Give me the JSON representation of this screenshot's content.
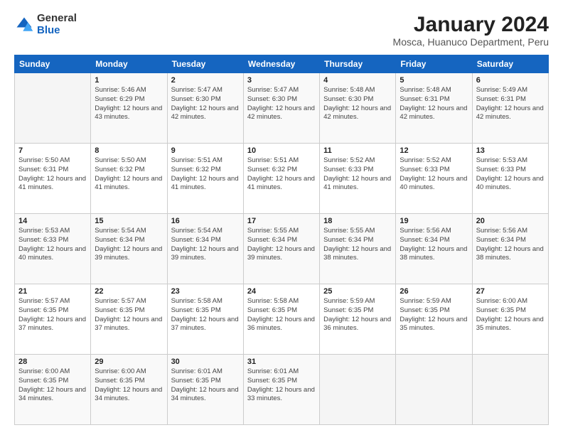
{
  "logo": {
    "general": "General",
    "blue": "Blue"
  },
  "header": {
    "title": "January 2024",
    "subtitle": "Mosca, Huanuco Department, Peru"
  },
  "weekdays": [
    "Sunday",
    "Monday",
    "Tuesday",
    "Wednesday",
    "Thursday",
    "Friday",
    "Saturday"
  ],
  "weeks": [
    [
      {
        "day": "",
        "sunrise": "",
        "sunset": "",
        "daylight": ""
      },
      {
        "day": "1",
        "sunrise": "Sunrise: 5:46 AM",
        "sunset": "Sunset: 6:29 PM",
        "daylight": "Daylight: 12 hours and 43 minutes."
      },
      {
        "day": "2",
        "sunrise": "Sunrise: 5:47 AM",
        "sunset": "Sunset: 6:30 PM",
        "daylight": "Daylight: 12 hours and 42 minutes."
      },
      {
        "day": "3",
        "sunrise": "Sunrise: 5:47 AM",
        "sunset": "Sunset: 6:30 PM",
        "daylight": "Daylight: 12 hours and 42 minutes."
      },
      {
        "day": "4",
        "sunrise": "Sunrise: 5:48 AM",
        "sunset": "Sunset: 6:30 PM",
        "daylight": "Daylight: 12 hours and 42 minutes."
      },
      {
        "day": "5",
        "sunrise": "Sunrise: 5:48 AM",
        "sunset": "Sunset: 6:31 PM",
        "daylight": "Daylight: 12 hours and 42 minutes."
      },
      {
        "day": "6",
        "sunrise": "Sunrise: 5:49 AM",
        "sunset": "Sunset: 6:31 PM",
        "daylight": "Daylight: 12 hours and 42 minutes."
      }
    ],
    [
      {
        "day": "7",
        "sunrise": "Sunrise: 5:50 AM",
        "sunset": "Sunset: 6:31 PM",
        "daylight": "Daylight: 12 hours and 41 minutes."
      },
      {
        "day": "8",
        "sunrise": "Sunrise: 5:50 AM",
        "sunset": "Sunset: 6:32 PM",
        "daylight": "Daylight: 12 hours and 41 minutes."
      },
      {
        "day": "9",
        "sunrise": "Sunrise: 5:51 AM",
        "sunset": "Sunset: 6:32 PM",
        "daylight": "Daylight: 12 hours and 41 minutes."
      },
      {
        "day": "10",
        "sunrise": "Sunrise: 5:51 AM",
        "sunset": "Sunset: 6:32 PM",
        "daylight": "Daylight: 12 hours and 41 minutes."
      },
      {
        "day": "11",
        "sunrise": "Sunrise: 5:52 AM",
        "sunset": "Sunset: 6:33 PM",
        "daylight": "Daylight: 12 hours and 41 minutes."
      },
      {
        "day": "12",
        "sunrise": "Sunrise: 5:52 AM",
        "sunset": "Sunset: 6:33 PM",
        "daylight": "Daylight: 12 hours and 40 minutes."
      },
      {
        "day": "13",
        "sunrise": "Sunrise: 5:53 AM",
        "sunset": "Sunset: 6:33 PM",
        "daylight": "Daylight: 12 hours and 40 minutes."
      }
    ],
    [
      {
        "day": "14",
        "sunrise": "Sunrise: 5:53 AM",
        "sunset": "Sunset: 6:33 PM",
        "daylight": "Daylight: 12 hours and 40 minutes."
      },
      {
        "day": "15",
        "sunrise": "Sunrise: 5:54 AM",
        "sunset": "Sunset: 6:34 PM",
        "daylight": "Daylight: 12 hours and 39 minutes."
      },
      {
        "day": "16",
        "sunrise": "Sunrise: 5:54 AM",
        "sunset": "Sunset: 6:34 PM",
        "daylight": "Daylight: 12 hours and 39 minutes."
      },
      {
        "day": "17",
        "sunrise": "Sunrise: 5:55 AM",
        "sunset": "Sunset: 6:34 PM",
        "daylight": "Daylight: 12 hours and 39 minutes."
      },
      {
        "day": "18",
        "sunrise": "Sunrise: 5:55 AM",
        "sunset": "Sunset: 6:34 PM",
        "daylight": "Daylight: 12 hours and 38 minutes."
      },
      {
        "day": "19",
        "sunrise": "Sunrise: 5:56 AM",
        "sunset": "Sunset: 6:34 PM",
        "daylight": "Daylight: 12 hours and 38 minutes."
      },
      {
        "day": "20",
        "sunrise": "Sunrise: 5:56 AM",
        "sunset": "Sunset: 6:34 PM",
        "daylight": "Daylight: 12 hours and 38 minutes."
      }
    ],
    [
      {
        "day": "21",
        "sunrise": "Sunrise: 5:57 AM",
        "sunset": "Sunset: 6:35 PM",
        "daylight": "Daylight: 12 hours and 37 minutes."
      },
      {
        "day": "22",
        "sunrise": "Sunrise: 5:57 AM",
        "sunset": "Sunset: 6:35 PM",
        "daylight": "Daylight: 12 hours and 37 minutes."
      },
      {
        "day": "23",
        "sunrise": "Sunrise: 5:58 AM",
        "sunset": "Sunset: 6:35 PM",
        "daylight": "Daylight: 12 hours and 37 minutes."
      },
      {
        "day": "24",
        "sunrise": "Sunrise: 5:58 AM",
        "sunset": "Sunset: 6:35 PM",
        "daylight": "Daylight: 12 hours and 36 minutes."
      },
      {
        "day": "25",
        "sunrise": "Sunrise: 5:59 AM",
        "sunset": "Sunset: 6:35 PM",
        "daylight": "Daylight: 12 hours and 36 minutes."
      },
      {
        "day": "26",
        "sunrise": "Sunrise: 5:59 AM",
        "sunset": "Sunset: 6:35 PM",
        "daylight": "Daylight: 12 hours and 35 minutes."
      },
      {
        "day": "27",
        "sunrise": "Sunrise: 6:00 AM",
        "sunset": "Sunset: 6:35 PM",
        "daylight": "Daylight: 12 hours and 35 minutes."
      }
    ],
    [
      {
        "day": "28",
        "sunrise": "Sunrise: 6:00 AM",
        "sunset": "Sunset: 6:35 PM",
        "daylight": "Daylight: 12 hours and 34 minutes."
      },
      {
        "day": "29",
        "sunrise": "Sunrise: 6:00 AM",
        "sunset": "Sunset: 6:35 PM",
        "daylight": "Daylight: 12 hours and 34 minutes."
      },
      {
        "day": "30",
        "sunrise": "Sunrise: 6:01 AM",
        "sunset": "Sunset: 6:35 PM",
        "daylight": "Daylight: 12 hours and 34 minutes."
      },
      {
        "day": "31",
        "sunrise": "Sunrise: 6:01 AM",
        "sunset": "Sunset: 6:35 PM",
        "daylight": "Daylight: 12 hours and 33 minutes."
      },
      {
        "day": "",
        "sunrise": "",
        "sunset": "",
        "daylight": ""
      },
      {
        "day": "",
        "sunrise": "",
        "sunset": "",
        "daylight": ""
      },
      {
        "day": "",
        "sunrise": "",
        "sunset": "",
        "daylight": ""
      }
    ]
  ]
}
